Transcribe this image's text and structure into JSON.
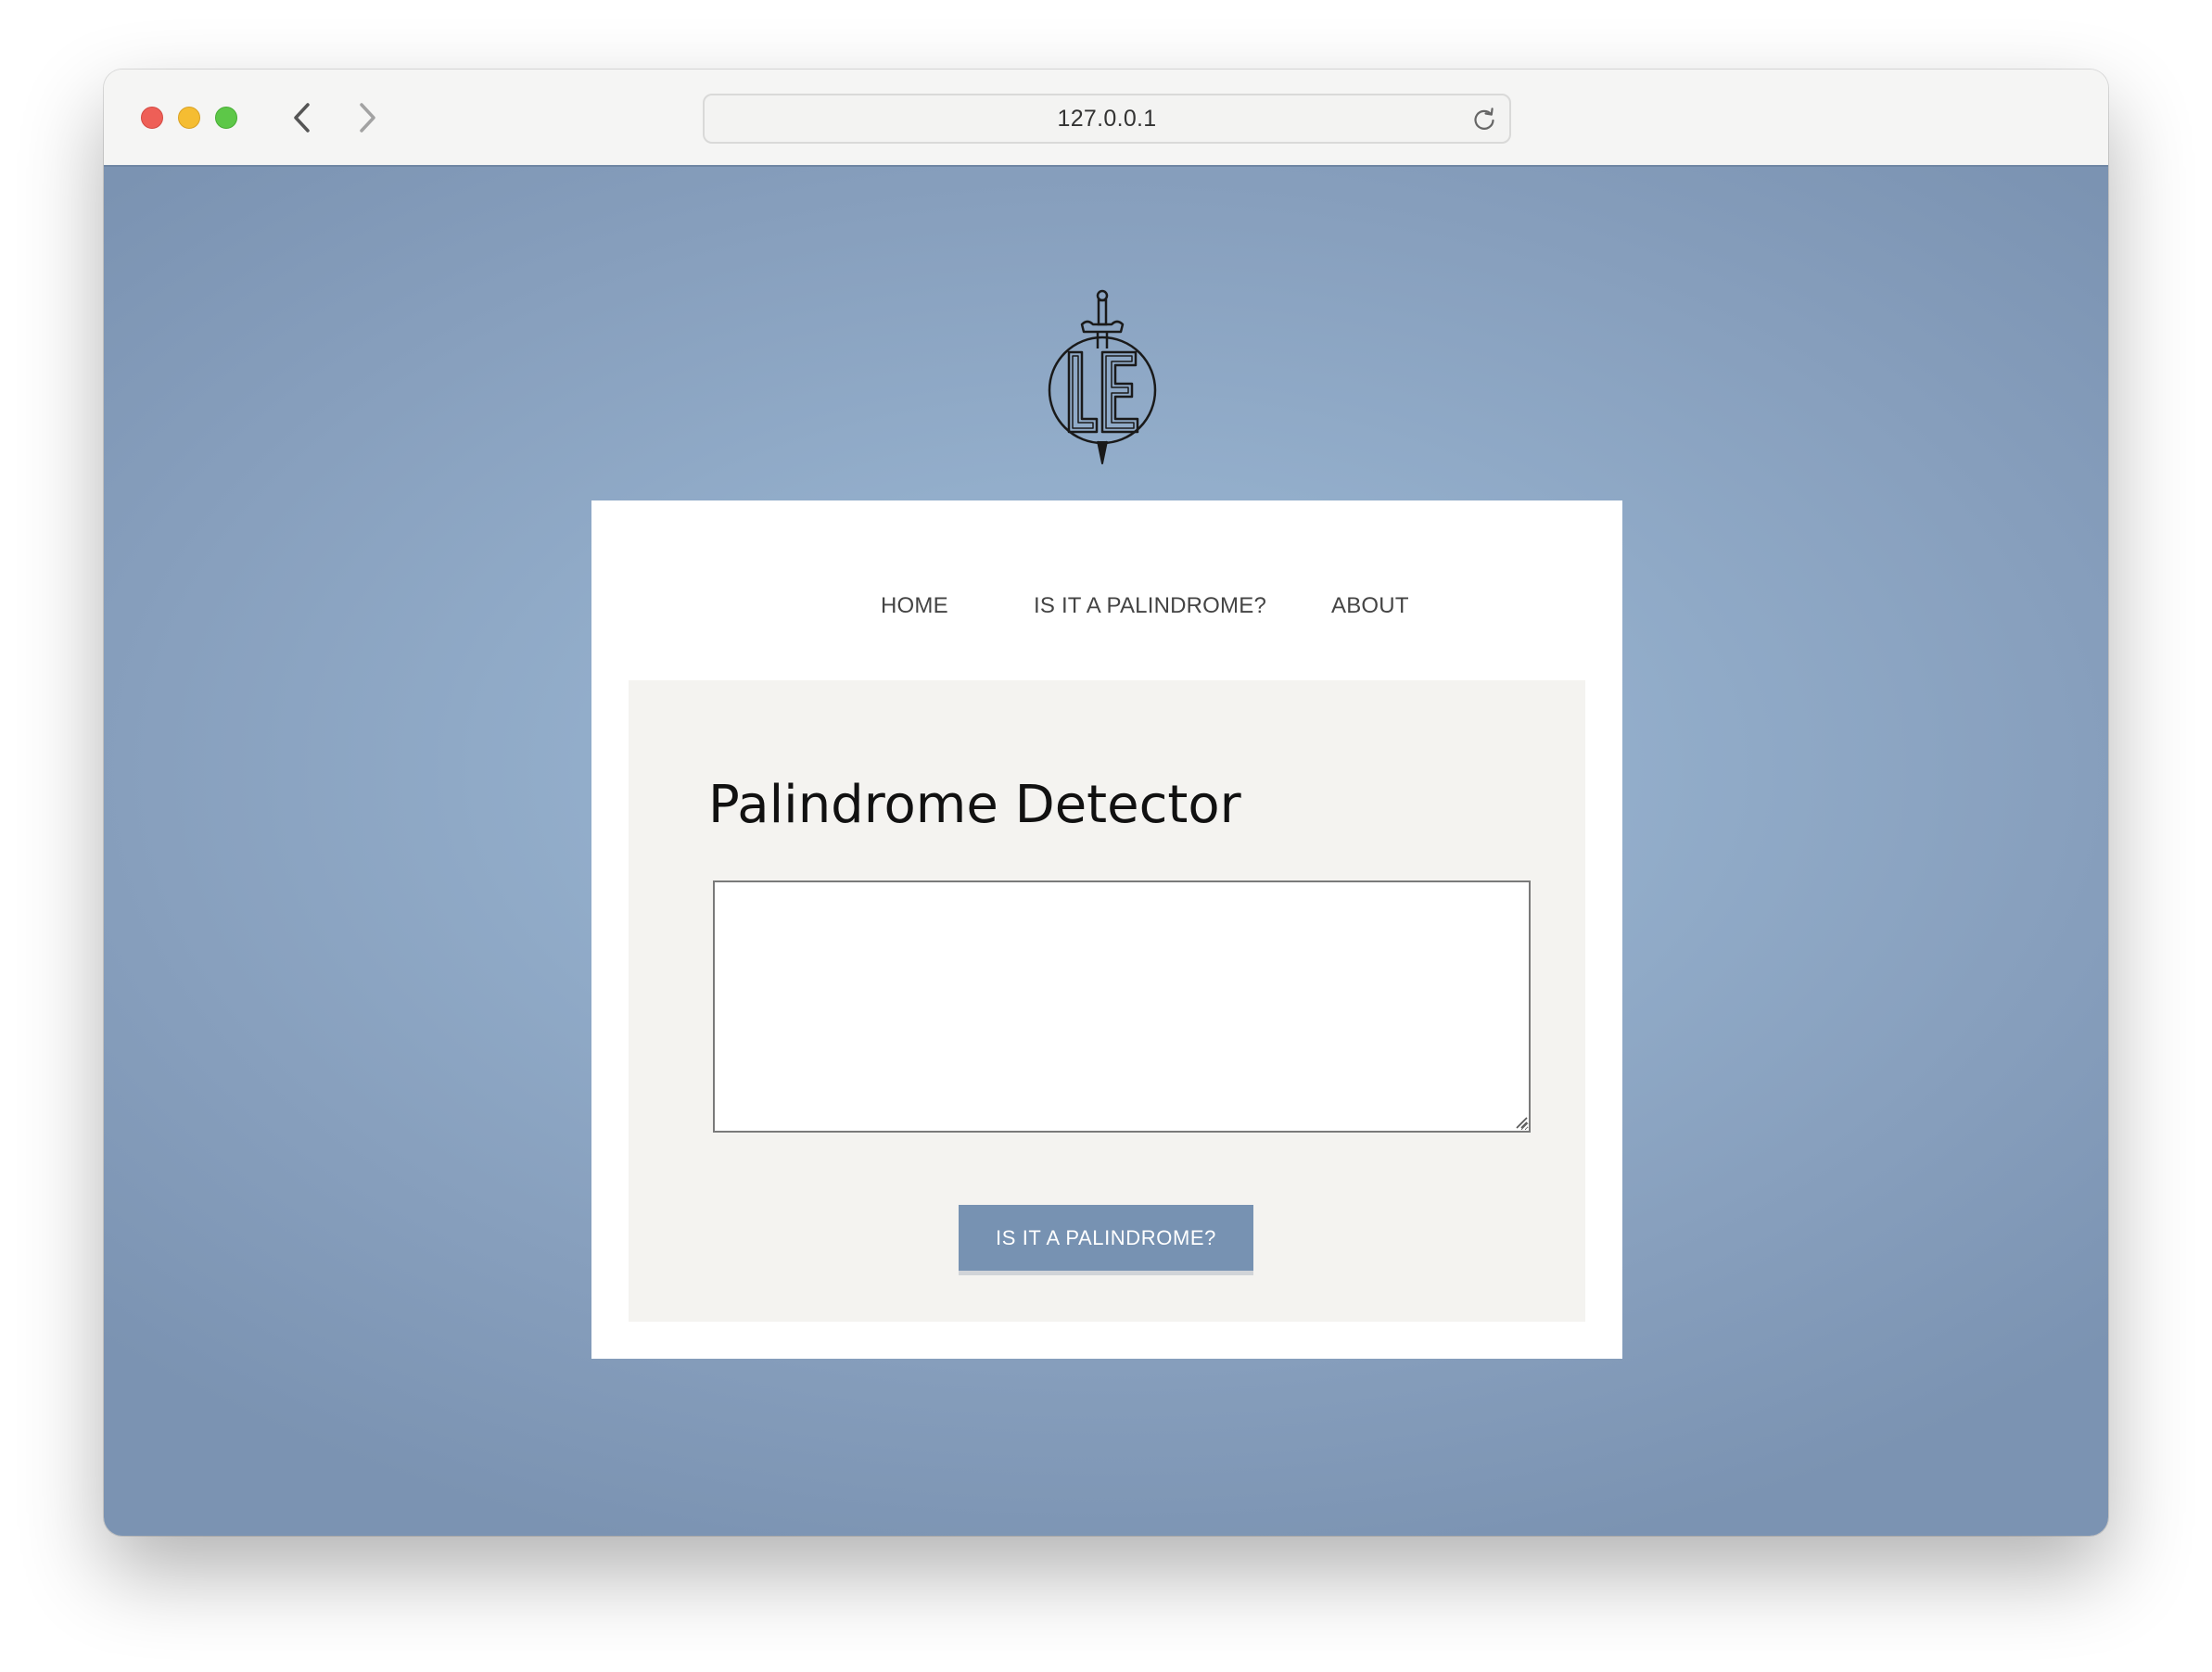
{
  "browser": {
    "url": "127.0.0.1",
    "icons": {
      "back": "chevron-left-icon",
      "forward": "chevron-right-icon",
      "reload": "reload-icon"
    }
  },
  "site": {
    "logo_text": "LE",
    "nav": {
      "home": "HOME",
      "palindrome": "IS IT A PALINDROME?",
      "about": "ABOUT"
    },
    "main": {
      "title": "Palindrome Detector",
      "input_value": "",
      "submit_label": "IS IT A PALINDROME?"
    }
  },
  "colors": {
    "background": "#93aecb",
    "button": "#7792b2",
    "panel": "#f4f3f0"
  }
}
